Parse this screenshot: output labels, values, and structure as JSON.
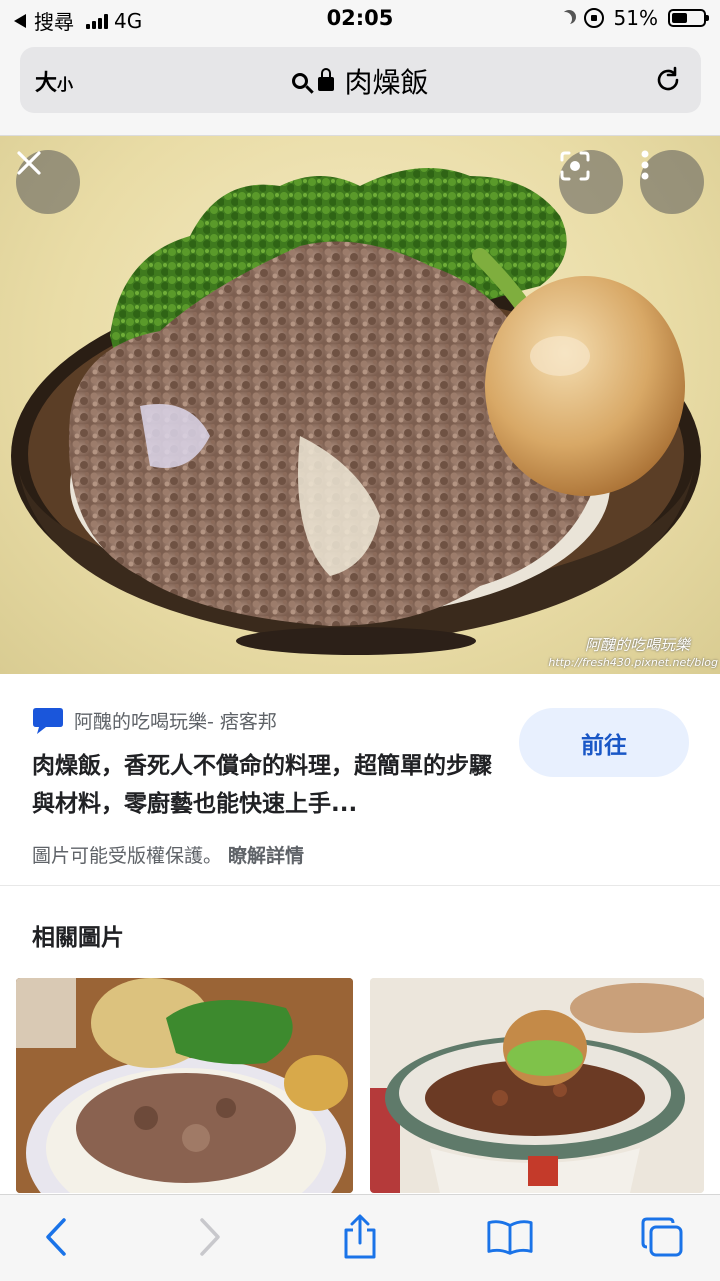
{
  "status_bar": {
    "back_app": "搜尋",
    "network": "4G",
    "time": "02:05",
    "battery_percent": "51%",
    "battery_level": 0.51
  },
  "address_bar": {
    "text_size_label_big": "大",
    "text_size_label_small": "小",
    "url_text": "肉燥飯"
  },
  "hero": {
    "watermark": "阿醜的吃喝玩樂",
    "watermark_url": "http://fresh430.pixnet.net/blog"
  },
  "result": {
    "site_name": "阿醜的吃喝玩樂- 痞客邦",
    "title": "肉燥飯，香死人不償命的料理，超簡單的步驟與材料，零廚藝也能快速上手...",
    "visit_label": "前往",
    "copyright_notice": "圖片可能受版權保護。",
    "learn_more": "瞭解詳情"
  },
  "related": {
    "title": "相關圖片"
  },
  "colors": {
    "accent_blue": "#1a73e8",
    "visit_bg": "#e8f0fe"
  }
}
